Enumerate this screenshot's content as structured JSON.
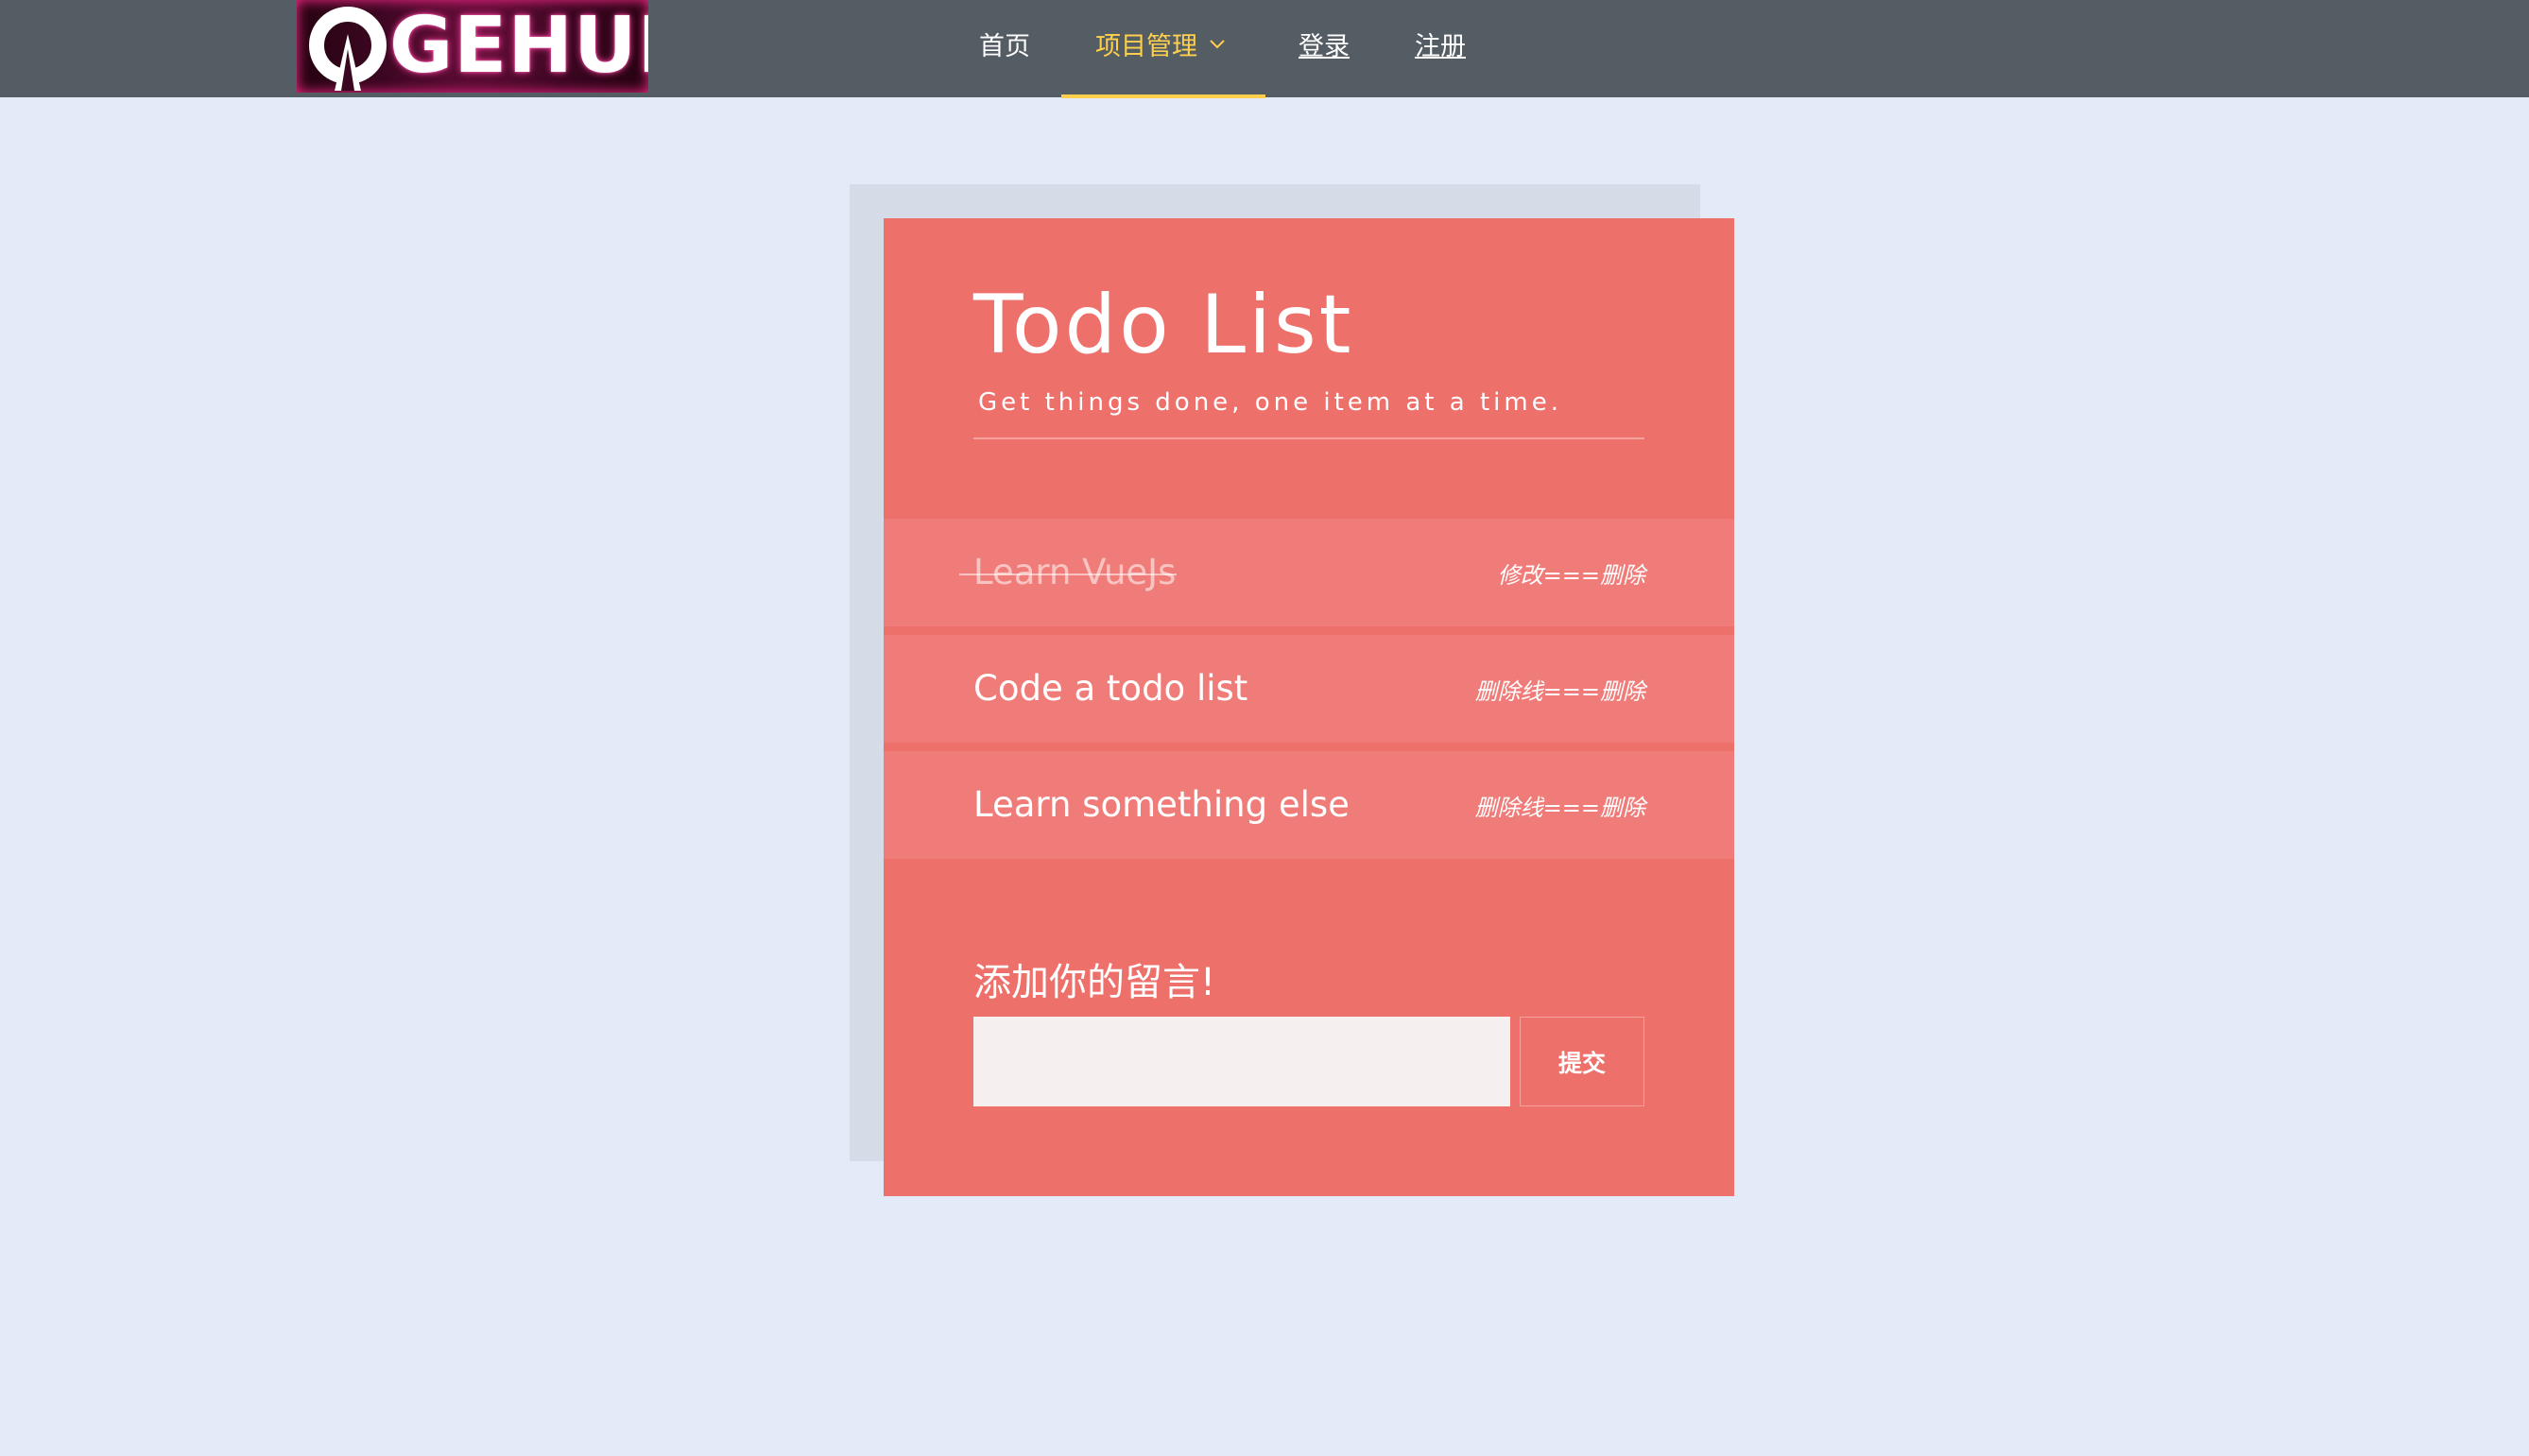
{
  "nav": {
    "logo_text": "GEHUI",
    "items": [
      {
        "label": "首页"
      },
      {
        "label": "项目管理"
      },
      {
        "label": "登录"
      },
      {
        "label": "注册"
      }
    ]
  },
  "todo": {
    "title": "Todo List",
    "subtitle": "Get things done, one item at a time.",
    "items": [
      {
        "text": "Learn VueJs",
        "actions": "修改===删除",
        "done": true
      },
      {
        "text": "Code a todo list",
        "actions": "删除线===删除",
        "done": false
      },
      {
        "text": "Learn something else",
        "actions": "删除线===删除",
        "done": false
      }
    ],
    "form": {
      "label": "添加你的留言!",
      "input_value": "",
      "submit_label": "提交"
    }
  },
  "colors": {
    "navbar": "#545c64",
    "nav_active": "#ffd04b",
    "card": "#ee706b",
    "item": "#f07c79",
    "page_bg": "#e4ebf8"
  },
  "icons": {
    "logo": "power-o-logo-icon",
    "dropdown": "chevron-down-icon"
  }
}
